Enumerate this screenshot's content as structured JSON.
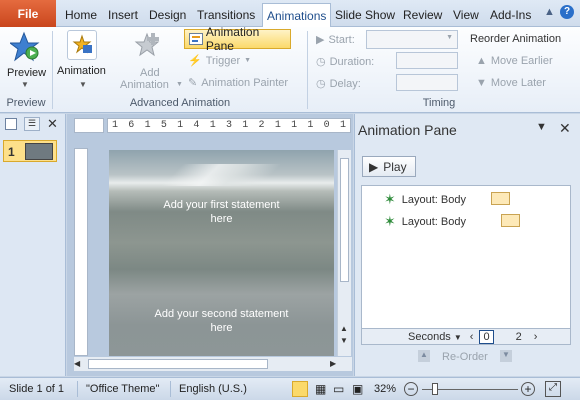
{
  "tabs": {
    "file": "File",
    "items": [
      "Home",
      "Insert",
      "Design",
      "Transitions",
      "Animations",
      "Slide Show",
      "Review",
      "View",
      "Add-Ins"
    ],
    "active": "Animations"
  },
  "ribbon": {
    "preview_btn": "Preview",
    "preview_group": "Preview",
    "animation_btn": "Animation",
    "add_animation_line1": "Add",
    "add_animation_line2": "Animation",
    "animation_pane_btn": "Animation Pane",
    "trigger_btn": "Trigger",
    "animation_painter_btn": "Animation Painter",
    "advanced_group": "Advanced Animation",
    "start_label": "Start:",
    "duration_label": "Duration:",
    "delay_label": "Delay:",
    "timing_group": "Timing",
    "reorder_title": "Reorder Animation",
    "move_earlier": "Move Earlier",
    "move_later": "Move Later"
  },
  "slides_panel": {
    "slide_number": "1"
  },
  "slide": {
    "statement1_line1": "Add your first statement",
    "statement1_line2": "here",
    "statement2_line1": "Add your second statement",
    "statement2_line2": "here"
  },
  "ruler": {
    "h_ticks": [
      "1",
      "6",
      "1",
      "5",
      "1",
      "4",
      "1",
      "3",
      "1",
      "2",
      "1",
      "1",
      "1",
      "0",
      "1"
    ]
  },
  "anim_pane": {
    "title": "Animation Pane",
    "play": "Play",
    "items": [
      {
        "label": "Layout: Body"
      },
      {
        "label": "Layout: Body"
      }
    ],
    "seconds_label": "Seconds",
    "timeline_start": "0",
    "timeline_end": "2",
    "reorder_label": "Re-Order"
  },
  "status": {
    "slide": "Slide 1 of 1",
    "theme": "\"Office Theme\"",
    "language": "English (U.S.)",
    "zoom": "32%"
  },
  "colors": {
    "accent": "#1f4e8c",
    "file_tab": "#d35428",
    "selection": "#fde9b8"
  }
}
